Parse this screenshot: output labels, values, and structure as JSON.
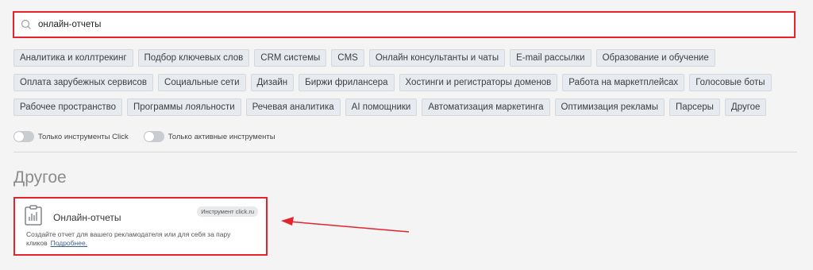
{
  "search": {
    "value": "онлайн-отчеты",
    "icon": "search-icon"
  },
  "tags": [
    [
      "Аналитика и коллтрекинг",
      "Подбор ключевых слов",
      "CRM системы",
      "CMS",
      "Онлайн консультанты и чаты",
      "E-mail рассылки",
      "Образование и обучение"
    ],
    [
      "Оплата зарубежных сервисов",
      "Социальные сети",
      "Дизайн",
      "Биржи фрилансера",
      "Хостинги и регистраторы доменов",
      "Работа на маркетплейсах",
      "Голосовые боты"
    ],
    [
      "Рабочее пространство",
      "Программы лояльности",
      "Речевая аналитика",
      "AI помощники",
      "Автоматизация маркетинга",
      "Оптимизация рекламы",
      "Парсеры",
      "Другое"
    ]
  ],
  "toggles": {
    "click_only": "Только инструменты Click",
    "active_only": "Только активные инструменты"
  },
  "section_title": "Другое",
  "card": {
    "title": "Онлайн-отчеты",
    "badge": "Инструмент click.ru",
    "description": "Создайте отчет для вашего рекламодателя или для себя за пару кликов",
    "more_link": "Подробнее."
  },
  "colors": {
    "highlight": "#e5232d",
    "tag_bg": "#e7eaee",
    "link": "#3a5f92"
  }
}
